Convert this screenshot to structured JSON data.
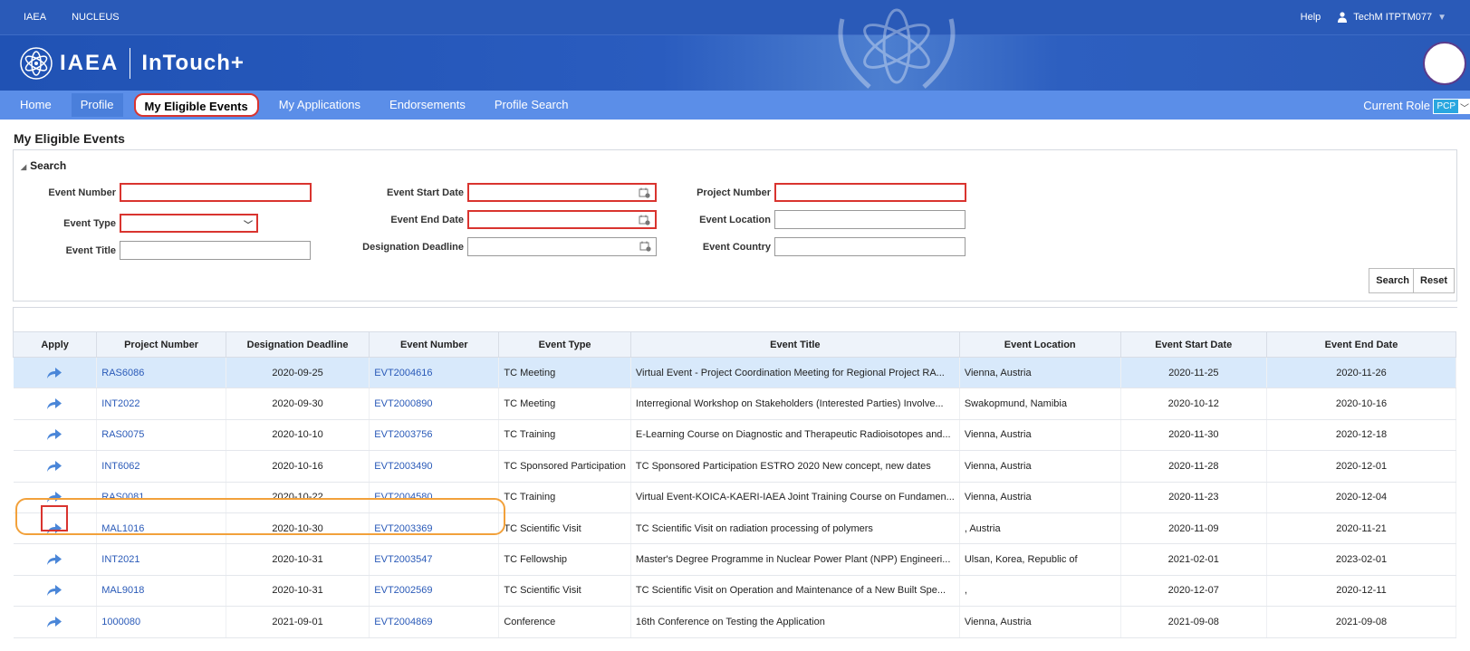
{
  "topbar": {
    "link1": "IAEA",
    "link2": "NUCLEUS",
    "help": "Help",
    "user": "TechM ITPTM077"
  },
  "banner": {
    "logo_text": "IAEA",
    "app_name": "InTouch+"
  },
  "nav": {
    "items": [
      "Home",
      "Profile",
      "My Eligible Events",
      "My Applications",
      "Endorsements",
      "Profile Search"
    ],
    "current_role_label": "Current Role",
    "current_role_value": "PCP"
  },
  "page": {
    "title": "My Eligible Events"
  },
  "search": {
    "heading": "Search",
    "labels": {
      "event_number": "Event Number",
      "event_type": "Event Type",
      "event_title": "Event Title",
      "event_start_date": "Event Start Date",
      "event_end_date": "Event End Date",
      "designation_deadline": "Designation Deadline",
      "project_number": "Project Number",
      "event_location": "Event Location",
      "event_country": "Event Country"
    },
    "buttons": {
      "search": "Search",
      "reset": "Reset"
    }
  },
  "table": {
    "headers": [
      "Apply",
      "Project Number",
      "Designation Deadline",
      "Event Number",
      "Event Type",
      "Event Title",
      "Event Location",
      "Event Start Date",
      "Event End Date"
    ],
    "rows": [
      {
        "project": "RAS6086",
        "deadline": "2020-09-25",
        "event": "EVT2004616",
        "type": "TC Meeting",
        "title": "Virtual Event - Project Coordination Meeting for Regional Project RA...",
        "location": "Vienna, Austria",
        "start": "2020-11-25",
        "end": "2020-11-26"
      },
      {
        "project": "INT2022",
        "deadline": "2020-09-30",
        "event": "EVT2000890",
        "type": "TC Meeting",
        "title": "Interregional Workshop on Stakeholders (Interested Parties) Involve...",
        "location": "Swakopmund, Namibia",
        "start": "2020-10-12",
        "end": "2020-10-16"
      },
      {
        "project": "RAS0075",
        "deadline": "2020-10-10",
        "event": "EVT2003756",
        "type": "TC Training",
        "title": "E-Learning Course on Diagnostic and Therapeutic Radioisotopes and...",
        "location": "Vienna, Austria",
        "start": "2020-11-30",
        "end": "2020-12-18"
      },
      {
        "project": "INT6062",
        "deadline": "2020-10-16",
        "event": "EVT2003490",
        "type": "TC Sponsored Participation",
        "title": "TC Sponsored Participation ESTRO 2020 New concept, new dates",
        "location": "Vienna, Austria",
        "start": "2020-11-28",
        "end": "2020-12-01"
      },
      {
        "project": "RAS0081",
        "deadline": "2020-10-22",
        "event": "EVT2004580",
        "type": "TC Training",
        "title": "Virtual Event-KOICA-KAERI-IAEA Joint Training Course on Fundamen...",
        "location": "Vienna, Austria",
        "start": "2020-11-23",
        "end": "2020-12-04"
      },
      {
        "project": "MAL1016",
        "deadline": "2020-10-30",
        "event": "EVT2003369",
        "type": "TC Scientific Visit",
        "title": "TC Scientific Visit on radiation processing of polymers",
        "location": ", Austria",
        "start": "2020-11-09",
        "end": "2020-11-21"
      },
      {
        "project": "INT2021",
        "deadline": "2020-10-31",
        "event": "EVT2003547",
        "type": "TC Fellowship",
        "title": "Master's Degree Programme in Nuclear Power Plant (NPP) Engineeri...",
        "location": "Ulsan, Korea, Republic of",
        "start": "2021-02-01",
        "end": "2023-02-01"
      },
      {
        "project": "MAL9018",
        "deadline": "2020-10-31",
        "event": "EVT2002569",
        "type": "TC Scientific Visit",
        "title": "TC Scientific Visit on Operation and Maintenance of a New Built Spe...",
        "location": ",",
        "start": "2020-12-07",
        "end": "2020-12-11"
      },
      {
        "project": "1000080",
        "deadline": "2021-09-01",
        "event": "EVT2004869",
        "type": "Conference",
        "title": "16th Conference on Testing the Application",
        "location": "Vienna, Austria",
        "start": "2021-09-08",
        "end": "2021-09-08"
      }
    ]
  },
  "colors": {
    "header_blue": "#2a5ab8",
    "nav_blue": "#5b8ee8",
    "link_blue": "#2a5ab8",
    "highlight_red": "#d9342f",
    "highlight_orange": "#f2a13b",
    "selected_row": "#d8e9fb"
  }
}
